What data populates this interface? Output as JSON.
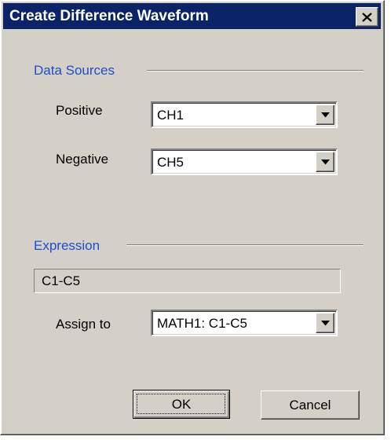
{
  "window": {
    "title": "Create Difference Waveform",
    "title_bar_color": "#0a2467",
    "close_icon": "close-icon"
  },
  "data_sources": {
    "heading": "Data Sources",
    "positive": {
      "label": "Positive",
      "value": "CH1"
    },
    "negative": {
      "label": "Negative",
      "value": "CH5"
    }
  },
  "expression": {
    "heading": "Expression",
    "value": "C1-C5",
    "assign_to": {
      "label": "Assign to",
      "value": "MATH1: C1-C5"
    }
  },
  "buttons": {
    "ok": "OK",
    "cancel": "Cancel"
  },
  "colors": {
    "section_heading": "#1b4fd0",
    "dialog_face": "#d4d0c8"
  }
}
